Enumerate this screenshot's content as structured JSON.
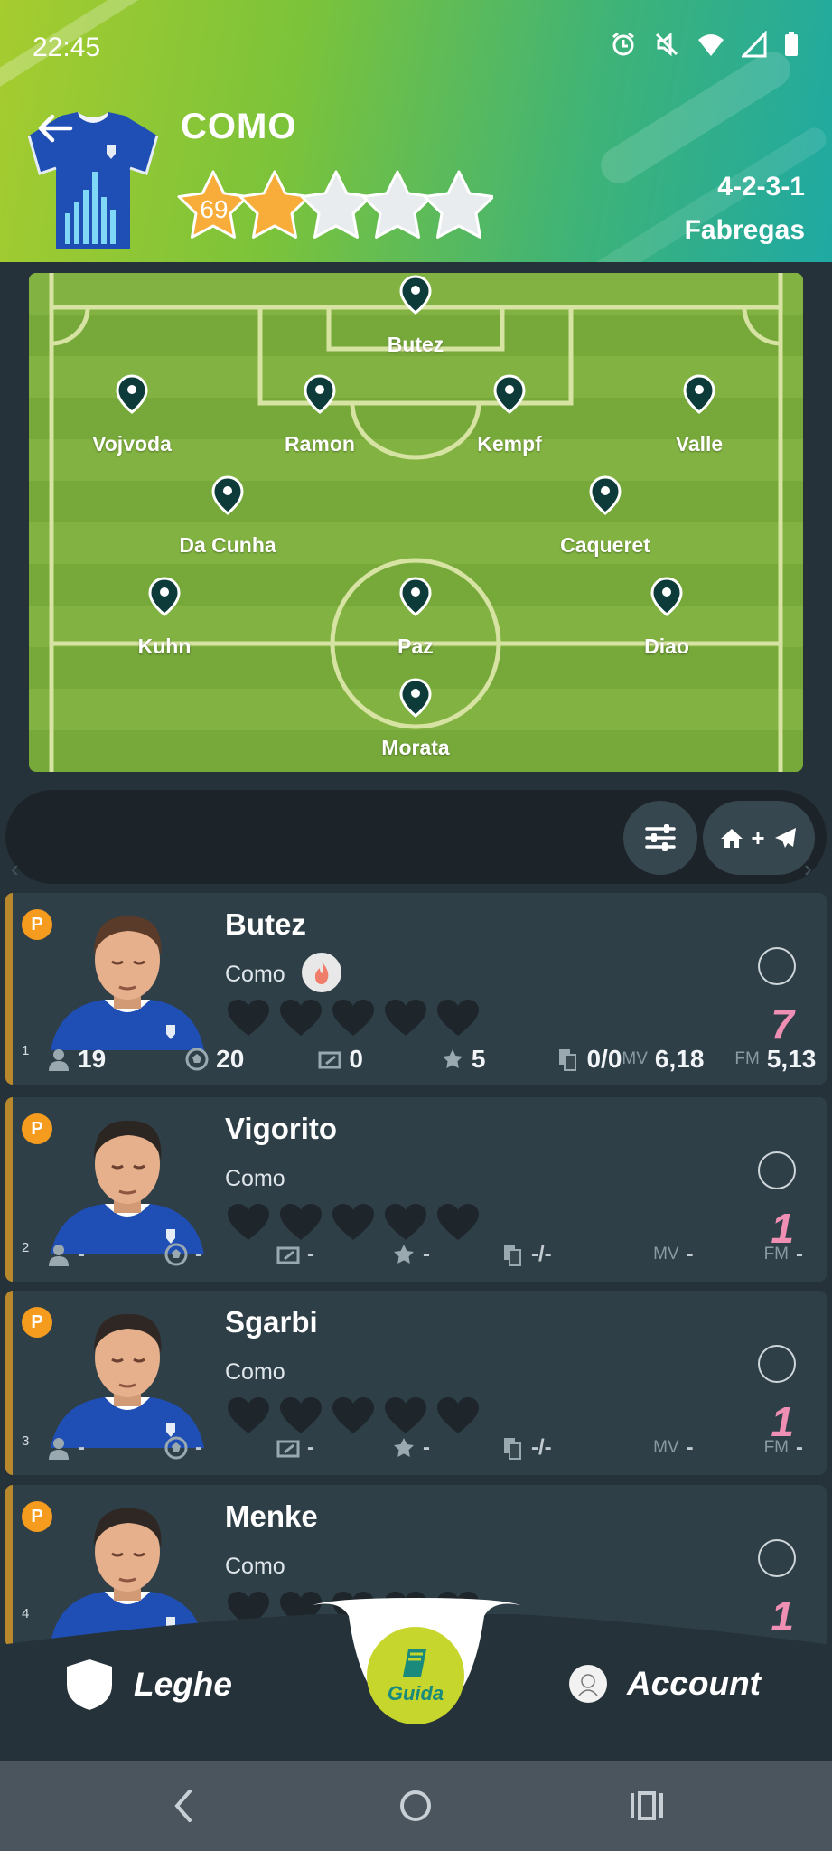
{
  "status": {
    "time": "22:45"
  },
  "header": {
    "team": "COMO",
    "rating": "69",
    "stars_filled": 2,
    "stars_total": 5,
    "formation": "4-2-3-1",
    "coach": "Fabregas"
  },
  "pitch": {
    "players": [
      {
        "name": "Butez"
      },
      {
        "name": "Vojvoda"
      },
      {
        "name": "Ramon"
      },
      {
        "name": "Kempf"
      },
      {
        "name": "Valle"
      },
      {
        "name": "Da Cunha"
      },
      {
        "name": "Caqueret"
      },
      {
        "name": "Kuhn"
      },
      {
        "name": "Paz"
      },
      {
        "name": "Diao"
      },
      {
        "name": "Morata"
      }
    ]
  },
  "toolbar": {
    "home_away_plus": "+"
  },
  "cards": [
    {
      "index": "1",
      "badge": "P",
      "name": "Butez",
      "team": "Como",
      "hot": true,
      "score": "7",
      "presences": "19",
      "goals": "20",
      "clean": "0",
      "assists": "5",
      "cards": "0/0",
      "mv_label": "MV",
      "mv": "6,18",
      "fm_label": "FM",
      "fm": "5,13"
    },
    {
      "index": "2",
      "badge": "P",
      "name": "Vigorito",
      "team": "Como",
      "hot": false,
      "score": "1",
      "presences": "-",
      "goals": "-",
      "clean": "-",
      "assists": "-",
      "cards": "-/-",
      "mv_label": "MV",
      "mv": "-",
      "fm_label": "FM",
      "fm": "-"
    },
    {
      "index": "3",
      "badge": "P",
      "name": "Sgarbi",
      "team": "Como",
      "hot": false,
      "score": "1",
      "presences": "-",
      "goals": "-",
      "clean": "-",
      "assists": "-",
      "cards": "-/-",
      "mv_label": "MV",
      "mv": "-",
      "fm_label": "FM",
      "fm": "-"
    },
    {
      "index": "4",
      "badge": "P",
      "name": "Menke",
      "team": "Como",
      "hot": false,
      "score": "1"
    }
  ],
  "bottom_nav": {
    "leagues": "Leghe",
    "guide": "Guida",
    "account": "Account"
  },
  "colors": {
    "accent_green": "#c6d62c",
    "score_pink": "#ee8fb3",
    "badge_orange": "#f59b1e",
    "card_bg": "#2f3f48"
  }
}
